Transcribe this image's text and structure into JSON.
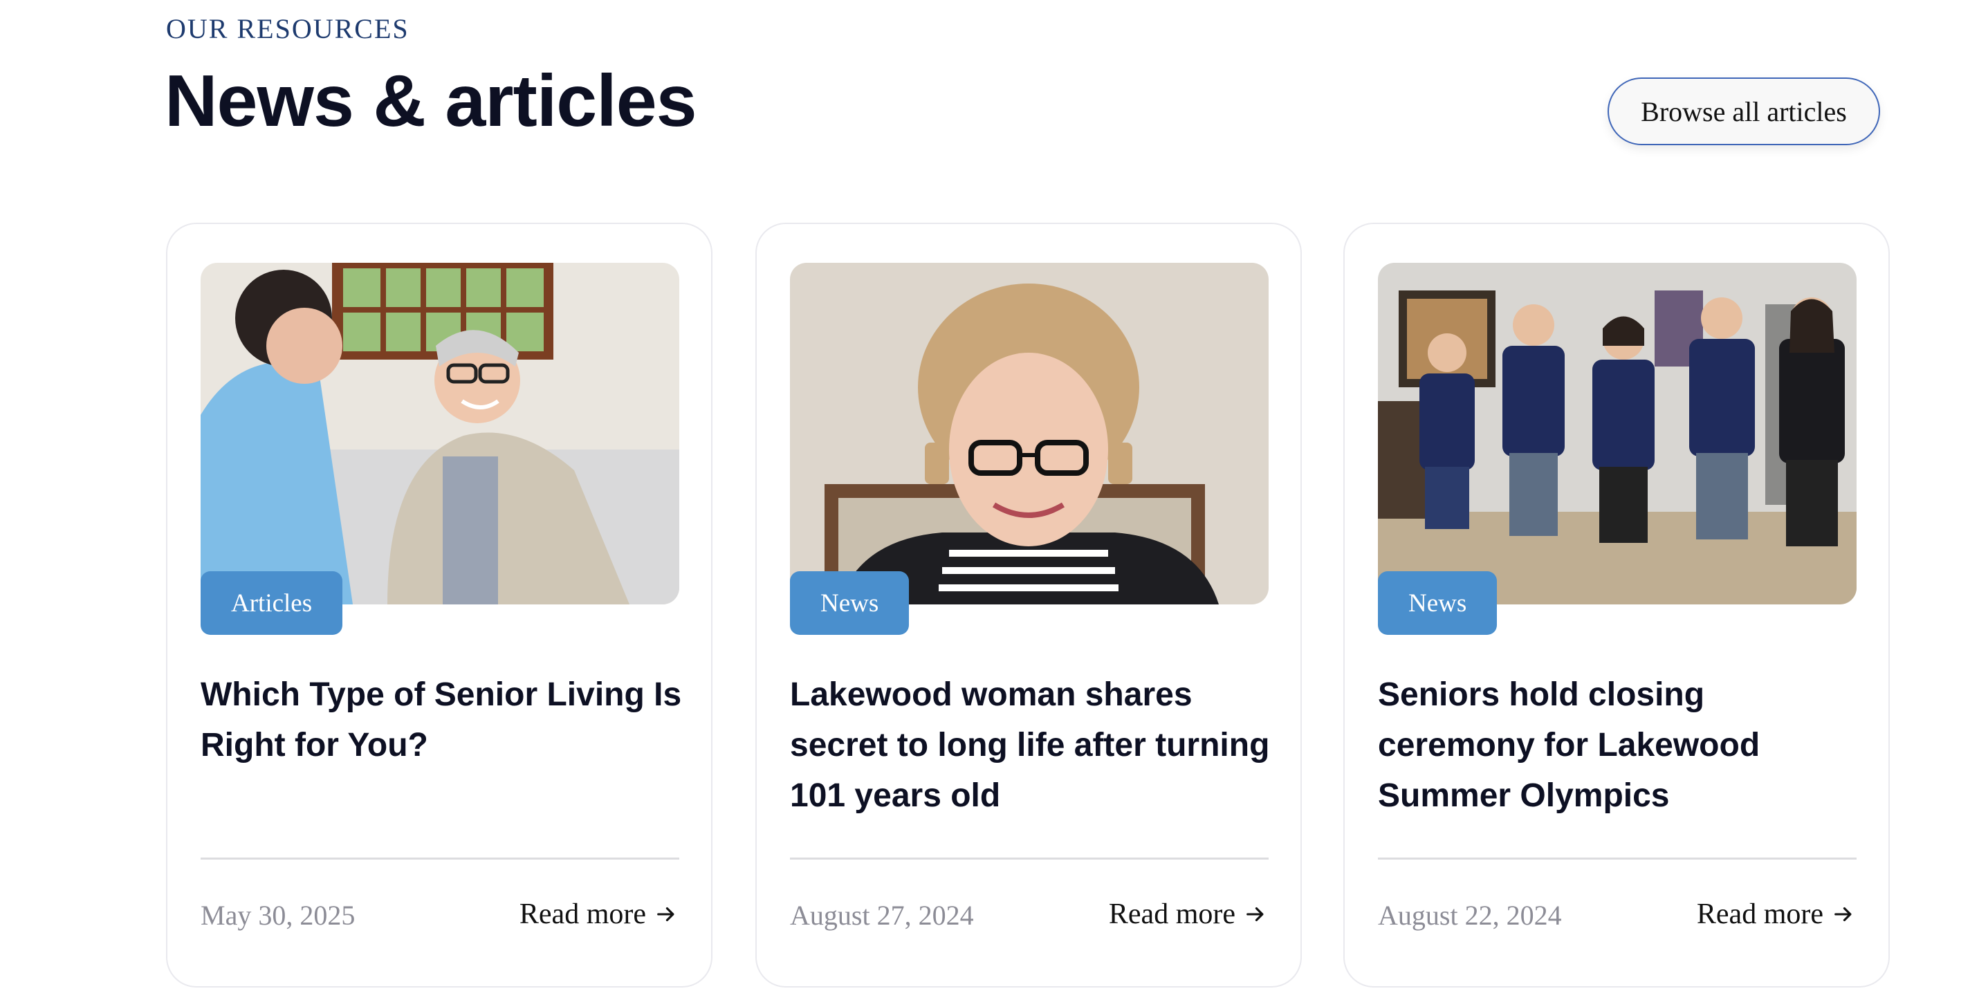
{
  "header": {
    "eyebrow": "OUR RESOURCES",
    "title": "News & articles",
    "browse_label": "Browse all articles"
  },
  "cards": [
    {
      "tag": "Articles",
      "title": "Which Type of Senior Living Is Right for You?",
      "date": "May 30, 2025",
      "read_more": "Read more",
      "image": "caregiver-and-smiling-senior-man-photo"
    },
    {
      "tag": "News",
      "title": "Lakewood woman shares secret to long life after turning 101 years old",
      "date": "August 27, 2024",
      "read_more": "Read more",
      "image": "smiling-senior-woman-with-glasses-photo"
    },
    {
      "tag": "News",
      "title": "Seniors hold closing ceremony for Lakewood Summer Olympics",
      "date": "August 22, 2024",
      "read_more": "Read more",
      "image": "group-of-seniors-with-medals-photo"
    }
  ],
  "colors": {
    "accent": "#4a8fcd",
    "heading": "#0d1023",
    "eyebrow": "#1d3a6e",
    "button_border": "#3f66b8",
    "date": "#8c8c96"
  }
}
